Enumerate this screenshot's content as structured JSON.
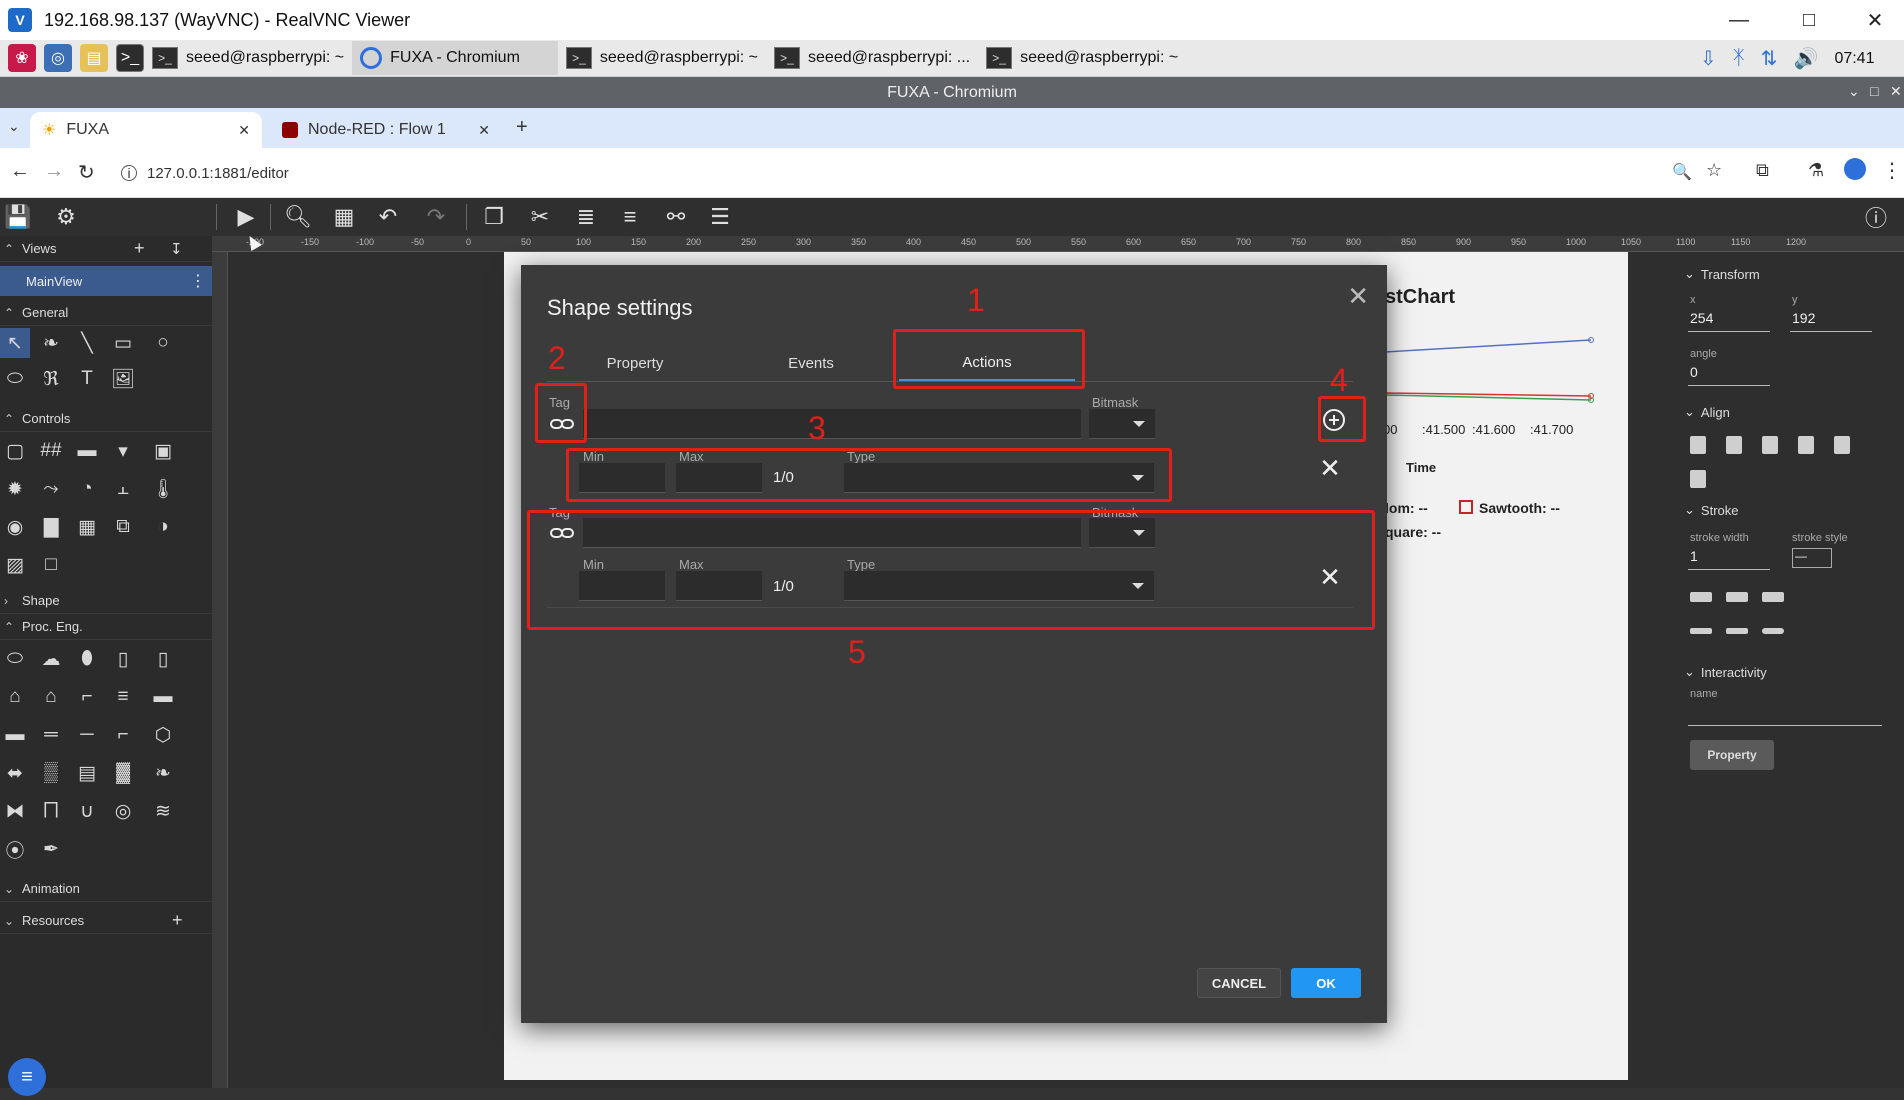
{
  "vnc": {
    "title": "192.168.98.137 (WayVNC) - RealVNC Viewer"
  },
  "taskbar": {
    "tasks": [
      "seeed@raspberrypi: ~",
      "FUXA - Chromium",
      "seeed@raspberrypi: ~",
      "seeed@raspberrypi: ...",
      "seeed@raspberrypi: ~"
    ],
    "clock": "07:41"
  },
  "browser": {
    "window_title": "FUXA - Chromium",
    "tabs": [
      {
        "label": "FUXA"
      },
      {
        "label": "Node-RED : Flow 1"
      }
    ],
    "url": "127.0.0.1:1881/editor"
  },
  "sidebar": {
    "views": "Views",
    "mainview": "MainView",
    "general": "General",
    "controls": "Controls",
    "shape": "Shape",
    "proc_eng": "Proc. Eng.",
    "animation": "Animation",
    "resources": "Resources"
  },
  "ruler": {
    "labels": [
      "-200",
      "-150",
      "-100",
      "-50",
      "0",
      "50",
      "100",
      "150",
      "200",
      "250",
      "300",
      "350",
      "400",
      "450",
      "500",
      "550",
      "600",
      "650",
      "700",
      "750",
      "800",
      "850",
      "900",
      "950",
      "1000",
      "1050",
      "1100",
      "1150",
      "1200"
    ]
  },
  "chart": {
    "title": "stChart",
    "ticks": [
      "00",
      ":41.500",
      ":41.600",
      ":41.700"
    ],
    "xlabel": "Time",
    "legend": [
      "lom: --",
      "Sawtooth: --",
      "quare: --"
    ]
  },
  "rightpanel": {
    "transform": "Transform",
    "x_label": "x",
    "x_value": "254",
    "y_label": "y",
    "y_value": "192",
    "angle_label": "angle",
    "angle_value": "0",
    "align": "Align",
    "stroke": "Stroke",
    "stroke_width_label": "stroke width",
    "stroke_width_value": "1",
    "stroke_style_label": "stroke style",
    "stroke_style_value": "—",
    "interactivity": "Interactivity",
    "name_label": "name",
    "property_btn": "Property"
  },
  "modal": {
    "title": "Shape settings",
    "tabs": [
      {
        "label": "Property"
      },
      {
        "label": "Events"
      },
      {
        "label": "Actions"
      }
    ],
    "tag_label": "Tag",
    "bitmask_label": "Bitmask",
    "min_label": "Min",
    "max_label": "Max",
    "type_label": "Type",
    "onezero": "1/0",
    "cancel": "CANCEL",
    "ok": "OK"
  },
  "annotations": [
    "1",
    "2",
    "3",
    "4",
    "5"
  ],
  "colors": {
    "accent": "#2196f3",
    "annotation": "#e0201a"
  }
}
